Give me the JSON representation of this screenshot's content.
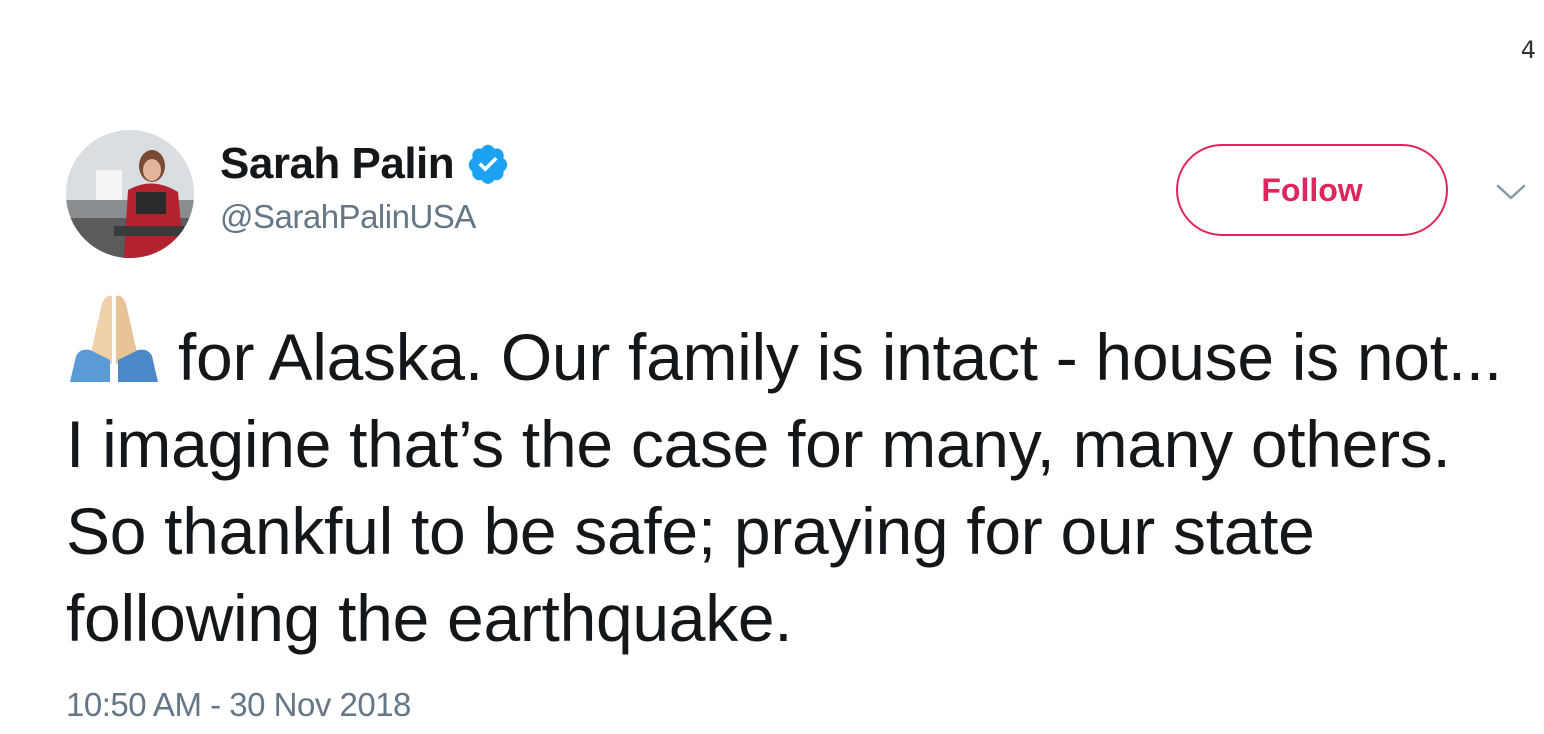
{
  "page_number": "4",
  "tweet": {
    "author": {
      "display_name": "Sarah Palin",
      "handle": "@SarahPalinUSA",
      "verified_icon": "verified-badge-icon",
      "avatar_icon": "profile-photo"
    },
    "follow_label": "Follow",
    "menu_icon": "chevron-down-icon",
    "emoji_icon": "folded-hands-emoji",
    "text": "for Alaska. Our family is intact - house is not... I imagine that’s the case for many, many others. So thankful to be safe; praying for our state following the earthquake.",
    "timestamp": "10:50 AM - 30 Nov 2018"
  },
  "colors": {
    "follow_accent": "#e0245e",
    "verified_blue": "#1da1f2",
    "secondary_text": "#657786",
    "primary_text": "#14171a"
  }
}
